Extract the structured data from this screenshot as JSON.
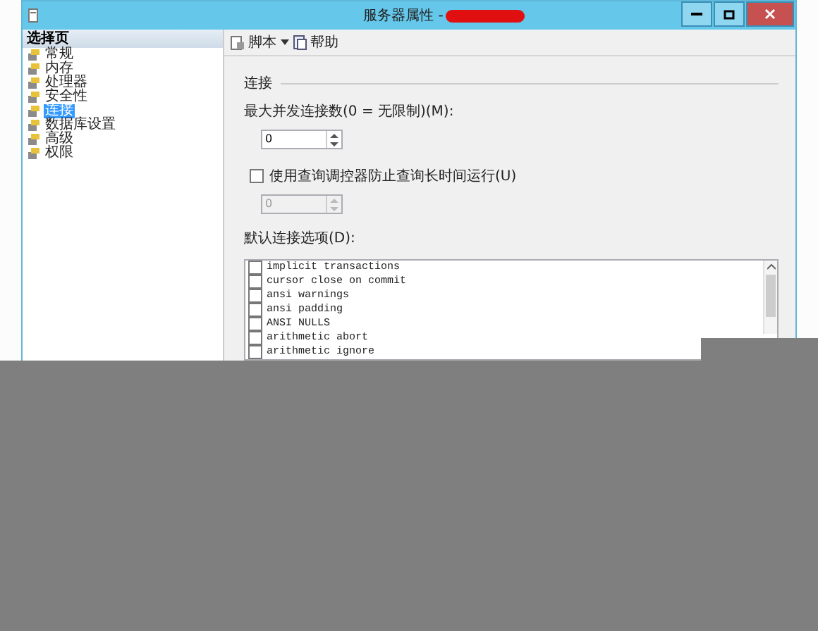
{
  "window": {
    "title": "服务器属性 -"
  },
  "sidebar": {
    "header": "选择页",
    "items": [
      {
        "label": "常规",
        "selected": false
      },
      {
        "label": "内存",
        "selected": false
      },
      {
        "label": "处理器",
        "selected": false
      },
      {
        "label": "安全性",
        "selected": false
      },
      {
        "label": "连接",
        "selected": true
      },
      {
        "label": "数据库设置",
        "selected": false
      },
      {
        "label": "高级",
        "selected": false
      },
      {
        "label": "权限",
        "selected": false
      }
    ]
  },
  "toolbar": {
    "script": "脚本",
    "help": "帮助"
  },
  "section": "连接",
  "max_connections": {
    "label": "最大并发连接数(0 = 无限制)(M):",
    "value": "0"
  },
  "governor": {
    "label": "使用查询调控器防止查询长时间运行(U)",
    "checked": false,
    "value": "0",
    "disabled": true
  },
  "default_options": {
    "label": "默认连接选项(D):",
    "options": [
      {
        "label": "implicit transactions",
        "checked": false
      },
      {
        "label": "cursor close on commit",
        "checked": false
      },
      {
        "label": "ansi warnings",
        "checked": false
      },
      {
        "label": "ansi padding",
        "checked": false
      },
      {
        "label": "ANSI NULLS",
        "checked": false
      },
      {
        "label": "arithmetic abort",
        "checked": false
      },
      {
        "label": "arithmetic ignore",
        "checked": false
      }
    ]
  }
}
